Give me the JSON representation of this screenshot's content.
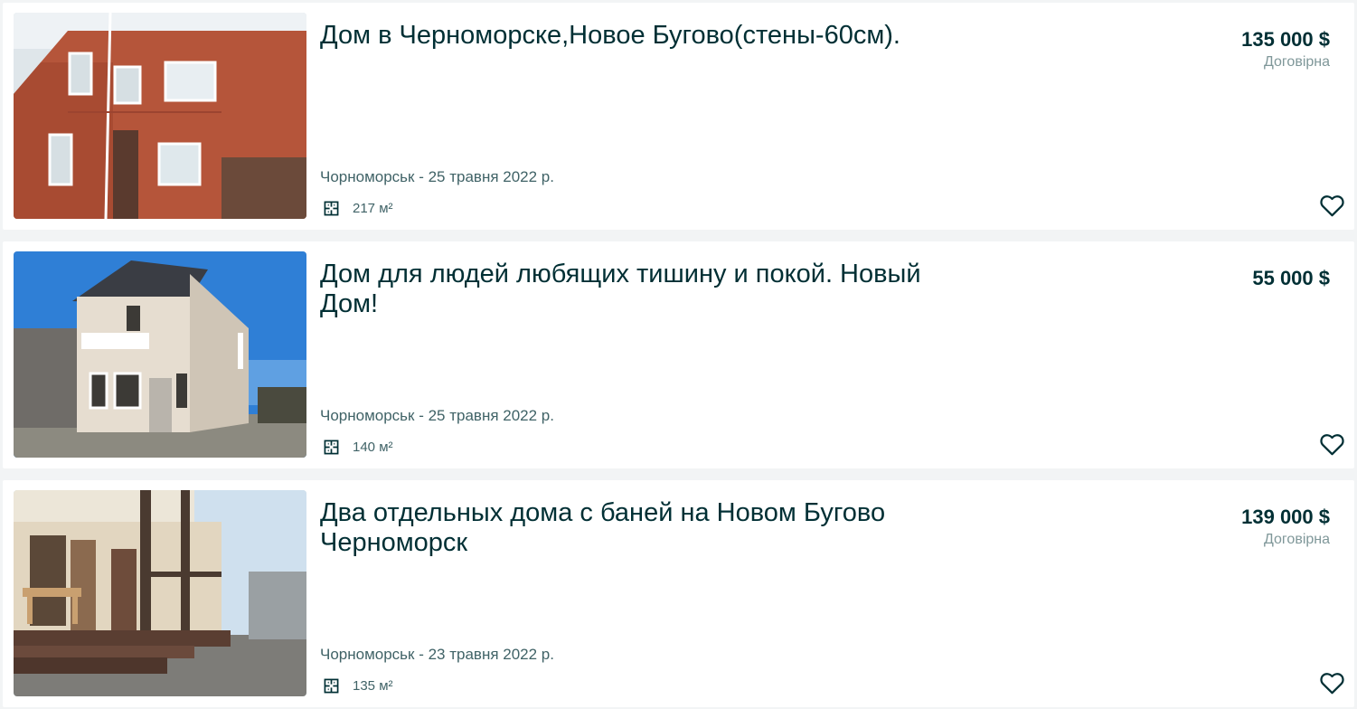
{
  "listings": [
    {
      "title": "Дом в Черноморске,Новое Бугово(стены-60см).",
      "price": "135 000 $",
      "negotiable": "Договірна",
      "location_date": "Чорноморськ - 25 травня 2022 р.",
      "area": "217 м²",
      "area_icon": "floor-plan-icon",
      "favorite_icon": "heart-icon"
    },
    {
      "title": "Дом для людей любящих тишину и покой. Новый Дом!",
      "price": "55 000 $",
      "negotiable": "",
      "location_date": "Чорноморськ - 25 травня 2022 р.",
      "area": "140 м²",
      "area_icon": "floor-plan-icon",
      "favorite_icon": "heart-icon"
    },
    {
      "title": "Два отдельных дома с баней на Новом Бугово Черноморск",
      "price": "139 000 $",
      "negotiable": "Договірна",
      "location_date": "Чорноморськ - 23 травня 2022 р.",
      "area": "135 м²",
      "area_icon": "floor-plan-icon",
      "favorite_icon": "heart-icon"
    }
  ],
  "colors": {
    "background": "#f2f4f5",
    "card": "#ffffff",
    "text_primary": "#002f34",
    "text_secondary": "#406367",
    "text_muted": "#7f9799"
  }
}
